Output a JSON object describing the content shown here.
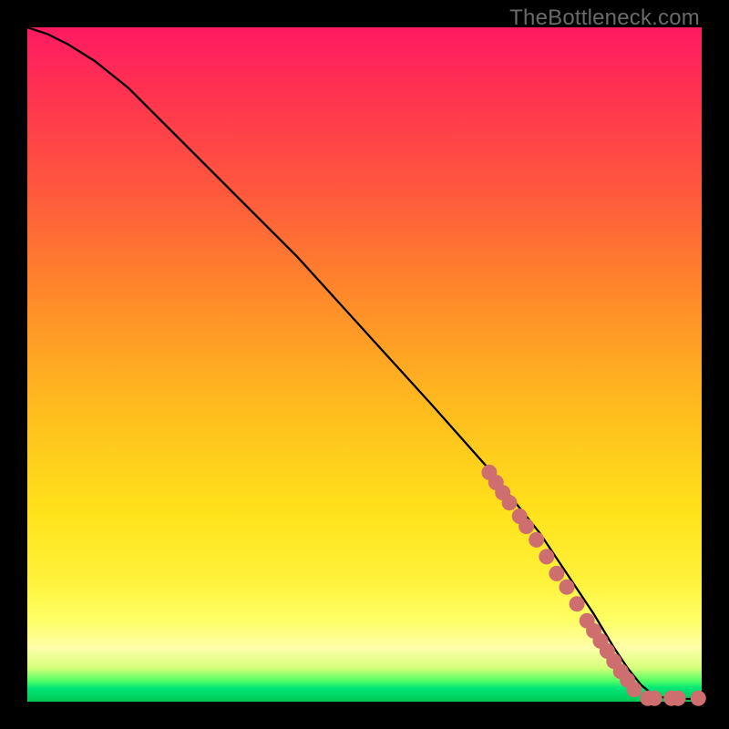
{
  "attribution": "TheBottleneck.com",
  "colors": {
    "background": "#000000",
    "curve": "#000000",
    "dots": "#cf6e6e",
    "gradient_top": "#ff1a62",
    "gradient_bottom": "#00c853"
  },
  "chart_data": {
    "type": "line",
    "title": "",
    "xlabel": "",
    "ylabel": "",
    "xlim": [
      0,
      100
    ],
    "ylim": [
      0,
      100
    ],
    "grid": false,
    "legend": false,
    "series": [
      {
        "name": "curve",
        "x": [
          0,
          3,
          6,
          10,
          15,
          20,
          30,
          40,
          50,
          60,
          68,
          72,
          76,
          80,
          84,
          87,
          89,
          91,
          93,
          96,
          100
        ],
        "y": [
          100,
          99,
          97.5,
          95,
          91,
          86,
          76,
          66,
          55,
          44,
          35,
          30,
          25,
          19,
          13,
          8,
          5,
          2.5,
          0.8,
          0.4,
          0.4
        ]
      }
    ],
    "points": [
      {
        "name": "cluster",
        "x": 68.5,
        "y": 34.0
      },
      {
        "name": "cluster",
        "x": 69.5,
        "y": 32.5
      },
      {
        "name": "cluster",
        "x": 70.5,
        "y": 31.0
      },
      {
        "name": "cluster",
        "x": 71.5,
        "y": 29.5
      },
      {
        "name": "cluster",
        "x": 73.0,
        "y": 27.5
      },
      {
        "name": "cluster",
        "x": 74.0,
        "y": 26.0
      },
      {
        "name": "cluster",
        "x": 75.5,
        "y": 24.0
      },
      {
        "name": "cluster",
        "x": 77.0,
        "y": 21.5
      },
      {
        "name": "cluster",
        "x": 78.5,
        "y": 19.0
      },
      {
        "name": "cluster",
        "x": 80.0,
        "y": 17.0
      },
      {
        "name": "cluster",
        "x": 81.5,
        "y": 14.5
      },
      {
        "name": "cluster",
        "x": 83.0,
        "y": 12.0
      },
      {
        "name": "cluster",
        "x": 84.0,
        "y": 10.5
      },
      {
        "name": "cluster",
        "x": 85.0,
        "y": 9.0
      },
      {
        "name": "cluster",
        "x": 86.0,
        "y": 7.5
      },
      {
        "name": "cluster",
        "x": 87.0,
        "y": 6.0
      },
      {
        "name": "cluster",
        "x": 88.0,
        "y": 4.5
      },
      {
        "name": "cluster",
        "x": 89.0,
        "y": 3.2
      },
      {
        "name": "cluster",
        "x": 90.0,
        "y": 1.8
      },
      {
        "name": "tail",
        "x": 92.0,
        "y": 0.5
      },
      {
        "name": "tail",
        "x": 93.0,
        "y": 0.5
      },
      {
        "name": "tail",
        "x": 95.5,
        "y": 0.5
      },
      {
        "name": "tail",
        "x": 96.5,
        "y": 0.5
      },
      {
        "name": "tail",
        "x": 99.5,
        "y": 0.5
      }
    ]
  }
}
